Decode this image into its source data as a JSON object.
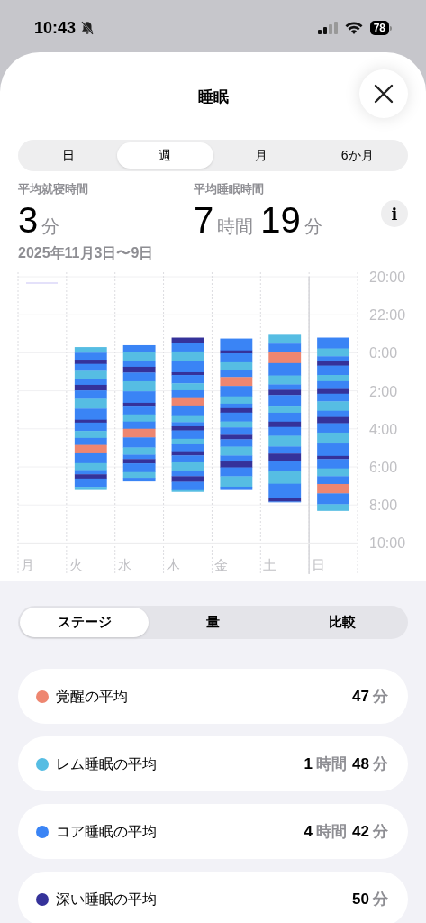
{
  "status_bar": {
    "time": "10:43",
    "battery": "78"
  },
  "title": "睡眠",
  "period_tabs": [
    {
      "label": "日",
      "selected": false
    },
    {
      "label": "週",
      "selected": true
    },
    {
      "label": "月",
      "selected": false
    },
    {
      "label": "6か月",
      "selected": false
    }
  ],
  "stats": [
    {
      "label": "平均就寝時間",
      "parts": [
        {
          "value": "3",
          "unit": "分"
        }
      ]
    },
    {
      "label": "平均睡眠時間",
      "parts": [
        {
          "value": "7",
          "unit": "時間"
        },
        {
          "value": "19",
          "unit": "分"
        }
      ]
    }
  ],
  "date_range": "2025年11月3日〜9日",
  "info_button": "i",
  "sleep_chart": {
    "x_labels": [
      "月",
      "火",
      "水",
      "木",
      "金",
      "土",
      "日"
    ],
    "y_labels": [
      "20:00",
      "22:00",
      "0:00",
      "2:00",
      "4:00",
      "6:00",
      "8:00",
      "10:00"
    ]
  },
  "view_tabs": [
    {
      "label": "ステージ",
      "selected": true
    },
    {
      "label": "量",
      "selected": false
    },
    {
      "label": "比較",
      "selected": false
    }
  ],
  "stages": [
    {
      "label": "覚醒の平均",
      "color": "#ee8670",
      "parts": [
        {
          "value": "47",
          "unit": "分"
        }
      ]
    },
    {
      "label": "レム睡眠の平均",
      "color": "#56bde3",
      "parts": [
        {
          "value": "1",
          "unit": "時間"
        },
        {
          "value": "48",
          "unit": "分"
        }
      ]
    },
    {
      "label": "コア睡眠の平均",
      "color": "#3a84f5",
      "parts": [
        {
          "value": "4",
          "unit": "時間"
        },
        {
          "value": "42",
          "unit": "分"
        }
      ]
    },
    {
      "label": "深い睡眠の平均",
      "color": "#35329a",
      "parts": [
        {
          "value": "50",
          "unit": "分"
        }
      ]
    }
  ]
}
